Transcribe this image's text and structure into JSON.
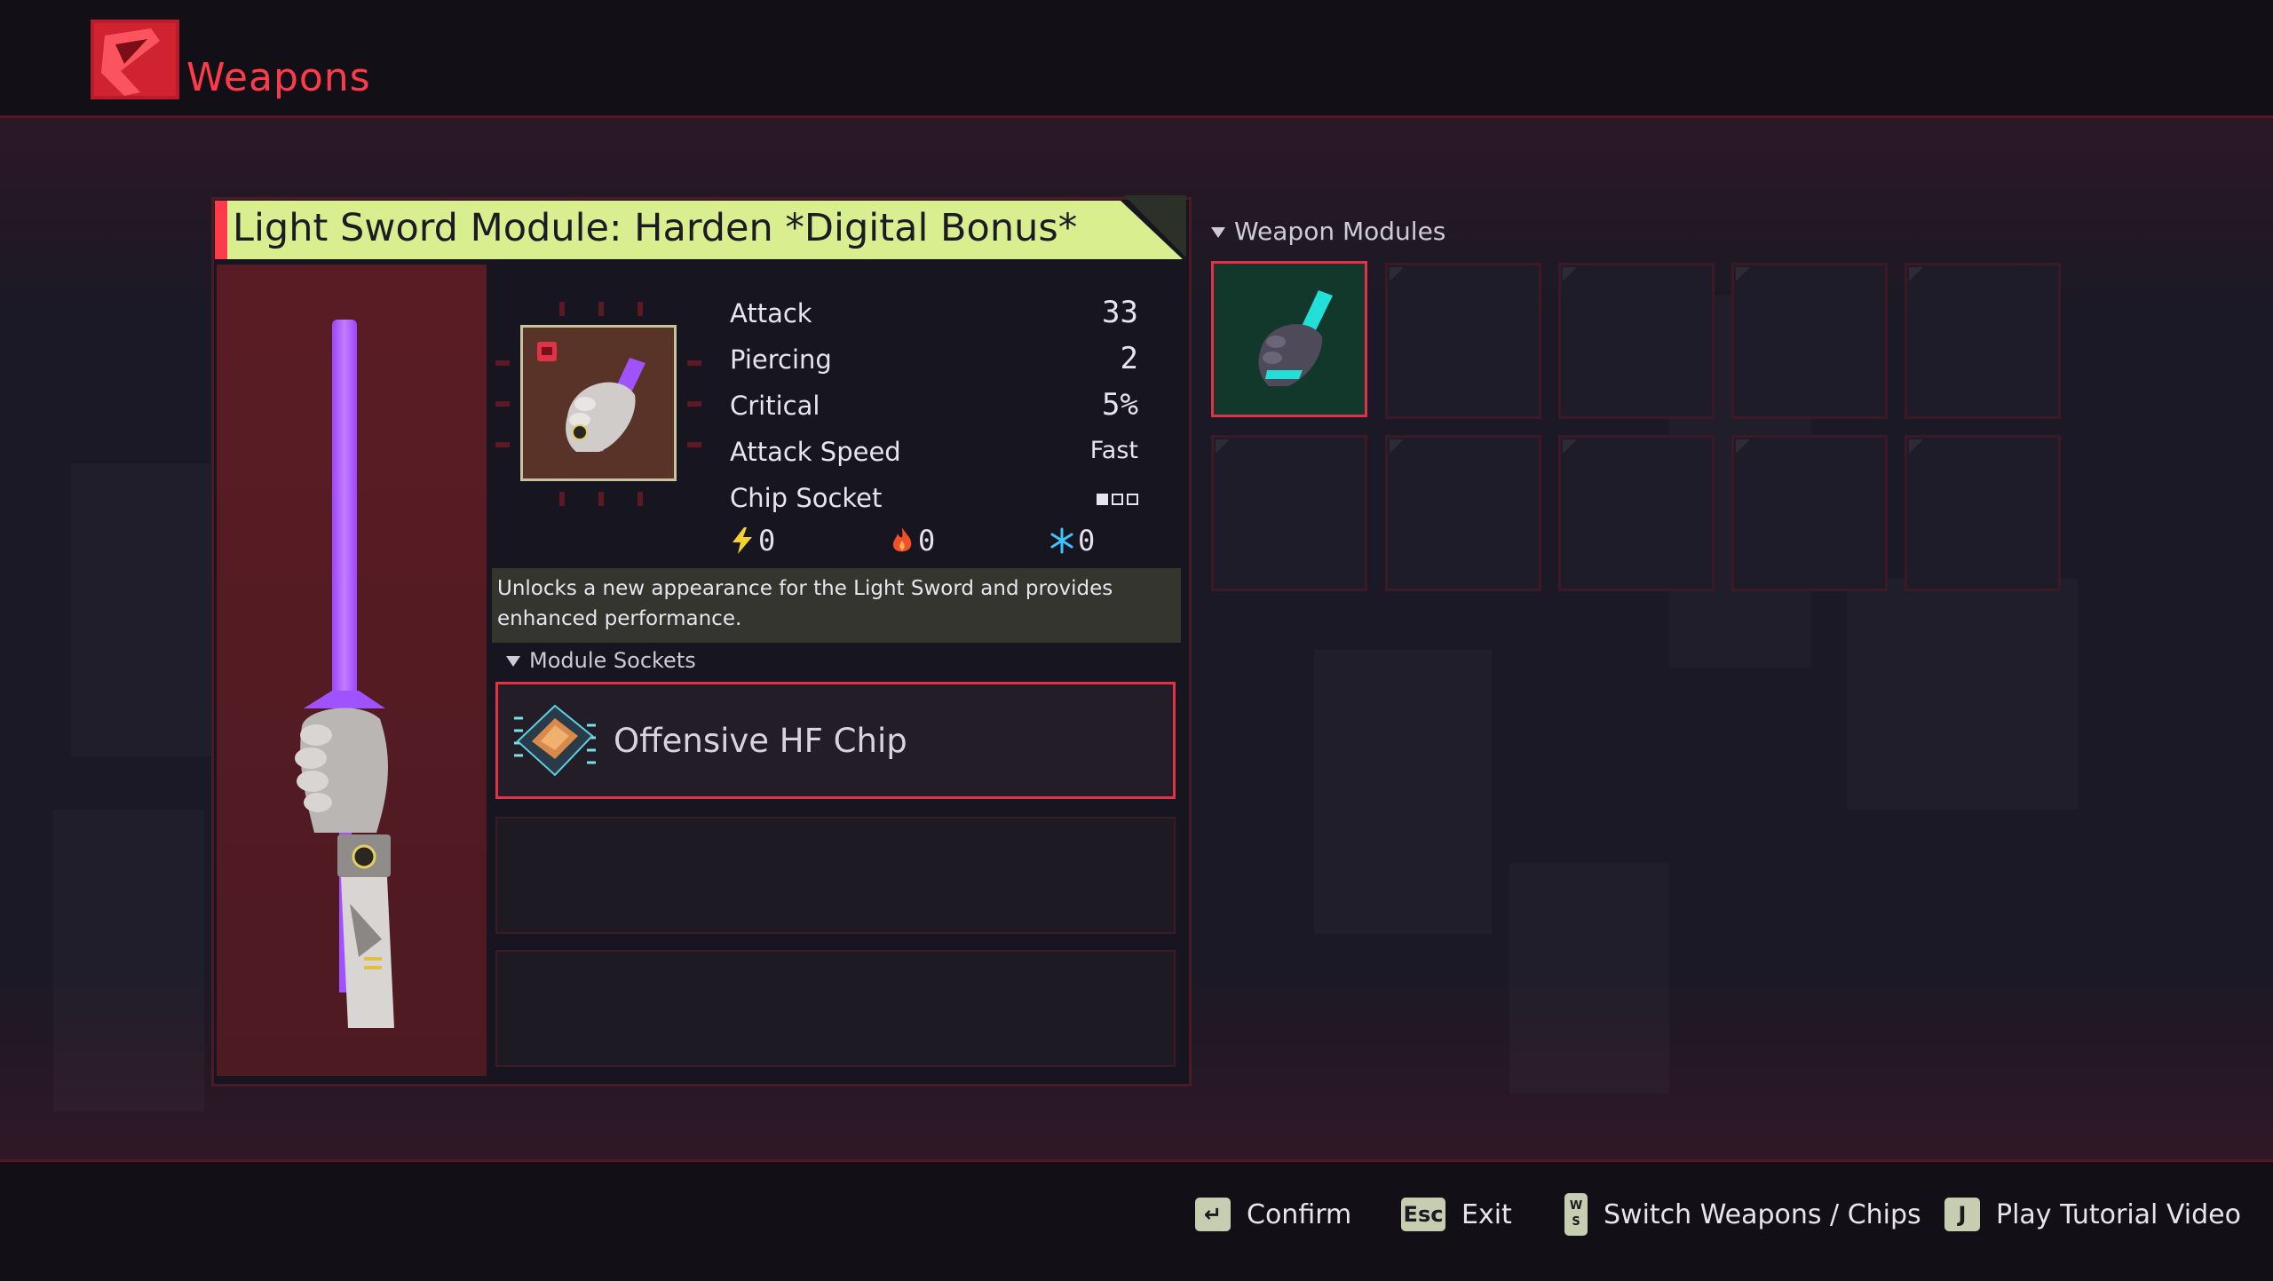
{
  "header": {
    "title": "Weapons"
  },
  "weapon": {
    "name": "Light Sword Module: Harden *Digital Bonus*",
    "stats": [
      {
        "label": "Attack",
        "value": "33"
      },
      {
        "label": "Piercing",
        "value": "2"
      },
      {
        "label": "Critical",
        "value": "5%"
      },
      {
        "label": "Attack Speed",
        "value": "Fast"
      },
      {
        "label": "Chip Socket",
        "filled": 1,
        "total": 3
      }
    ],
    "elements": [
      {
        "icon": "lightning-icon",
        "value": "0"
      },
      {
        "icon": "fire-icon",
        "value": "0"
      },
      {
        "icon": "snowflake-icon",
        "value": "0"
      }
    ],
    "description": "Unlocks a new appearance for the Light Sword and provides enhanced performance."
  },
  "module_sockets": {
    "label": "Module Sockets",
    "slots": [
      {
        "name": "Offensive HF Chip",
        "icon": "chip-icon"
      },
      {
        "name": ""
      },
      {
        "name": ""
      }
    ]
  },
  "weapon_modules": {
    "label": "Weapon Modules",
    "selected_index": 0,
    "count": 10
  },
  "controls": [
    {
      "key": "↵",
      "label": "Confirm"
    },
    {
      "key": "Esc",
      "label": "Exit"
    },
    {
      "key": "W S",
      "label": "Switch Weapons / Chips"
    },
    {
      "key": "J",
      "label": "Play Tutorial Video"
    }
  ],
  "colors": {
    "accent_red": "#ff3a4a",
    "header_lime": "#d8ee8f",
    "beam_purple": "#b05cff",
    "module_cyan": "#22e0d8"
  }
}
